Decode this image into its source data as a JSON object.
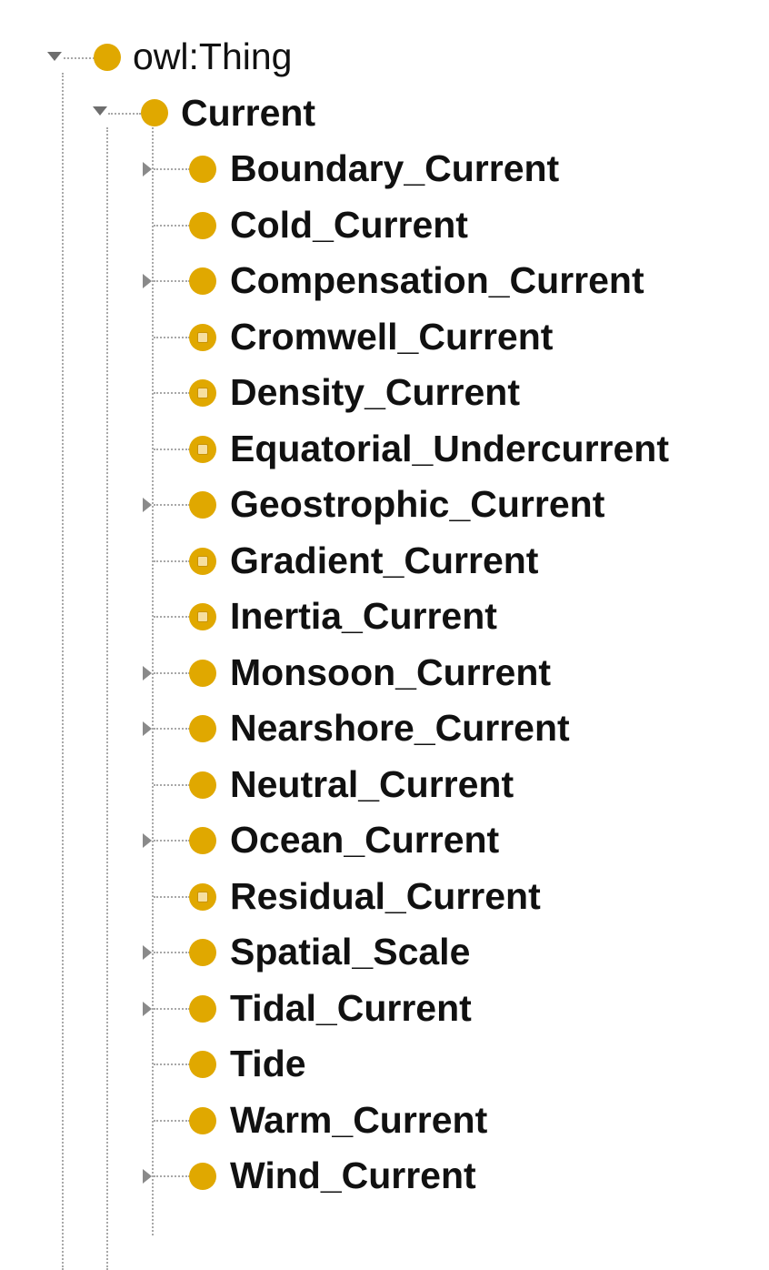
{
  "colors": {
    "class_icon": "#e0a800",
    "connector": "#a8a8a8",
    "text": "#111111"
  },
  "root": {
    "label": "owl:Thing",
    "icon": "class-icon",
    "expanded": true
  },
  "current": {
    "label": "Current",
    "icon": "class-icon",
    "expanded": true
  },
  "children": [
    {
      "label": "Boundary_Current",
      "has_children": true,
      "icon": "class-icon"
    },
    {
      "label": "Cold_Current",
      "has_children": false,
      "icon": "class-icon"
    },
    {
      "label": "Compensation_Current",
      "has_children": true,
      "icon": "class-icon"
    },
    {
      "label": "Cromwell_Current",
      "has_children": false,
      "icon": "defined-class-icon"
    },
    {
      "label": "Density_Current",
      "has_children": false,
      "icon": "defined-class-icon"
    },
    {
      "label": "Equatorial_Undercurrent",
      "has_children": false,
      "icon": "defined-class-icon"
    },
    {
      "label": "Geostrophic_Current",
      "has_children": true,
      "icon": "class-icon"
    },
    {
      "label": "Gradient_Current",
      "has_children": false,
      "icon": "defined-class-icon"
    },
    {
      "label": "Inertia_Current",
      "has_children": false,
      "icon": "defined-class-icon"
    },
    {
      "label": "Monsoon_Current",
      "has_children": true,
      "icon": "class-icon"
    },
    {
      "label": "Nearshore_Current",
      "has_children": true,
      "icon": "class-icon"
    },
    {
      "label": "Neutral_Current",
      "has_children": false,
      "icon": "class-icon"
    },
    {
      "label": "Ocean_Current",
      "has_children": true,
      "icon": "class-icon"
    },
    {
      "label": "Residual_Current",
      "has_children": false,
      "icon": "defined-class-icon"
    },
    {
      "label": "Spatial_Scale",
      "has_children": true,
      "icon": "class-icon"
    },
    {
      "label": "Tidal_Current",
      "has_children": true,
      "icon": "class-icon"
    },
    {
      "label": "Tide",
      "has_children": false,
      "icon": "class-icon"
    },
    {
      "label": "Warm_Current",
      "has_children": false,
      "icon": "class-icon"
    },
    {
      "label": "Wind_Current",
      "has_children": true,
      "icon": "class-icon"
    }
  ]
}
